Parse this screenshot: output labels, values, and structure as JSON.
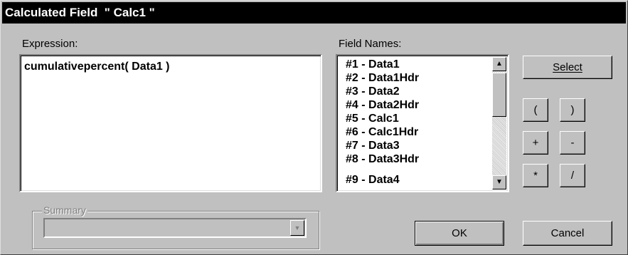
{
  "dialog": {
    "title": "Calculated Field  \" Calc1 \""
  },
  "expression": {
    "label": "Expression:",
    "value": "cumulativepercent( Data1 )"
  },
  "field_names": {
    "label": "Field Names:",
    "items": [
      "#1 - Data1",
      "#2 - Data1Hdr",
      "#3 - Data2",
      "#4 - Data2Hdr",
      "#5 - Calc1",
      "#6 - Calc1Hdr",
      "#7 - Data3",
      "#8 - Data3Hdr",
      "#9 - Data4"
    ]
  },
  "buttons": {
    "select": "Select",
    "open_paren": "(",
    "close_paren": ")",
    "plus": "+",
    "minus": "-",
    "multiply": "*",
    "divide": "/",
    "ok": "OK",
    "cancel": "Cancel"
  },
  "summary": {
    "label": "Summary",
    "value": ""
  }
}
